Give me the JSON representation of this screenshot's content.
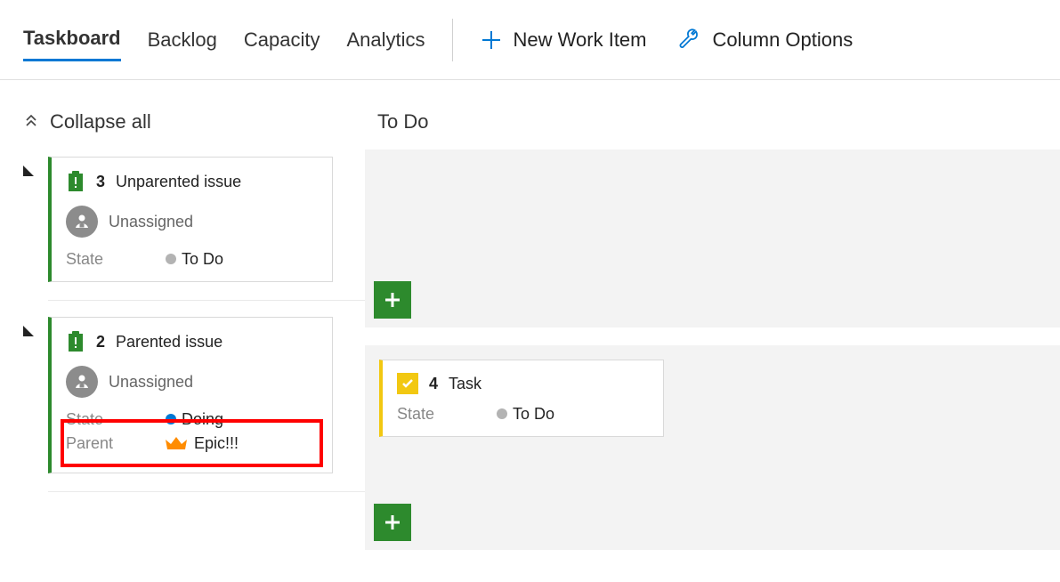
{
  "tabs": {
    "taskboard": "Taskboard",
    "backlog": "Backlog",
    "capacity": "Capacity",
    "analytics": "Analytics"
  },
  "actions": {
    "newWorkItem": "New Work Item",
    "columnOptions": "Column Options"
  },
  "collapse": "Collapse all",
  "column": {
    "todo": "To Do"
  },
  "cards": {
    "unparented": {
      "id": "3",
      "title": "Unparented issue",
      "assignee": "Unassigned",
      "stateLabel": "State",
      "stateValue": "To Do"
    },
    "parented": {
      "id": "2",
      "title": "Parented issue",
      "assignee": "Unassigned",
      "stateLabel": "State",
      "stateValue": "Doing",
      "parentLabel": "Parent",
      "parentValue": "Epic!!!"
    },
    "task": {
      "id": "4",
      "title": "Task",
      "stateLabel": "State",
      "stateValue": "To Do"
    }
  }
}
